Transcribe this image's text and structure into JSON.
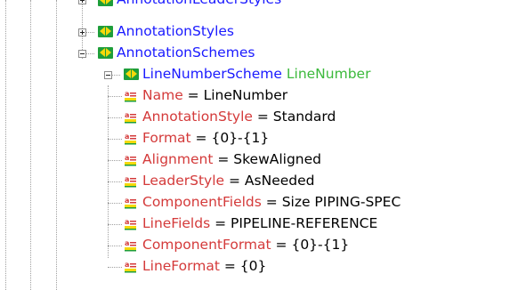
{
  "tree": {
    "collapsed_nodes": [
      {
        "label": "AnnotationLeaderStyles"
      },
      {
        "label": "AnnotationStyles"
      }
    ],
    "expanded_node": {
      "label": "AnnotationSchemes"
    },
    "scheme": {
      "type": "LineNumberScheme",
      "name": "LineNumber"
    },
    "attributes": [
      {
        "name": "Name",
        "eq": " = ",
        "value": "LineNumber"
      },
      {
        "name": "AnnotationStyle",
        "eq": " = ",
        "value": "Standard"
      },
      {
        "name": "Format",
        "eq": " = ",
        "value": "{0}-{1}"
      },
      {
        "name": "Alignment",
        "eq": " = ",
        "value": "SkewAligned"
      },
      {
        "name": "LeaderStyle",
        "eq": " = ",
        "value": "AsNeeded"
      },
      {
        "name": "ComponentFields",
        "eq": " = ",
        "value": "Size PIPING-SPEC"
      },
      {
        "name": "LineFields",
        "eq": " = ",
        "value": "PIPELINE-REFERENCE"
      },
      {
        "name": "ComponentFormat",
        "eq": " = ",
        "value": "{0}-{1}"
      },
      {
        "name": "LineFormat",
        "eq": " = ",
        "value": "{0}"
      }
    ]
  },
  "icons": {
    "node": "xml-element-icon",
    "attribute": "xml-attribute-icon"
  },
  "colors": {
    "element_name": "#1a1aff",
    "attribute_name": "#d43a3a",
    "scheme_name": "#3cb93c",
    "value": "#000000",
    "node_icon_green": "#1e9e3a",
    "node_icon_yellow": "#f5d90a"
  }
}
